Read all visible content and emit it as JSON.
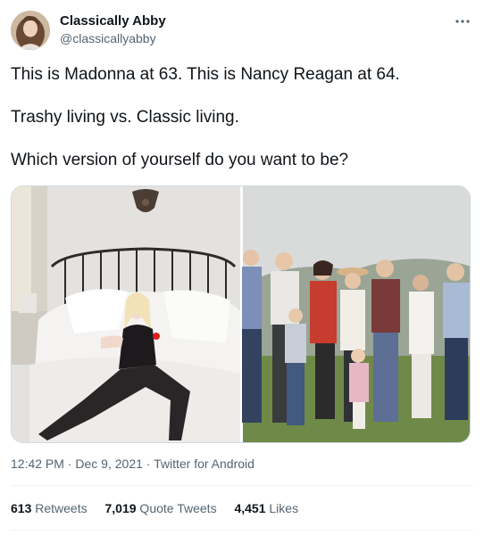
{
  "author": {
    "name": "Classically Abby",
    "handle": "@classicallyabby"
  },
  "more_icon": "more-horizontal-icon",
  "tweet_text": {
    "line1": "This is Madonna at 63. This is Nancy Reagan at 64.",
    "line2": "Trashy living vs. Classic living.",
    "line3": "Which version of yourself do you want to be?"
  },
  "timestamp": {
    "time": "12:42 PM",
    "sep1": " · ",
    "date": "Dec 9, 2021",
    "sep2": " · ",
    "source": "Twitter for Android"
  },
  "stats": {
    "retweets_count": "613",
    "retweets_label": " Retweets",
    "quotes_count": "7,019",
    "quotes_label": " Quote Tweets",
    "likes_count": "4,451",
    "likes_label": " Likes"
  },
  "colors": {
    "text_primary": "#0f1419",
    "text_secondary": "#536471",
    "border": "#eff3f4"
  }
}
